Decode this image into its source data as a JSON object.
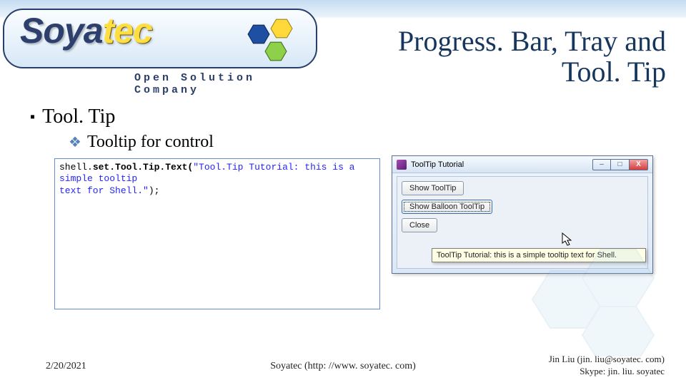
{
  "logo": {
    "brand_main": "Soya",
    "brand_alt": "tec",
    "tagline": "Open Solution Company"
  },
  "title_line1": "Progress. Bar, Tray and",
  "title_line2": "Tool. Tip",
  "bullet1": "Tool. Tip",
  "bullet2": "Tooltip for control",
  "code": {
    "part1": "shell.",
    "bold": "set.Tool.Tip.Text(",
    "str1": "\"Tool.Tip Tutorial: this is a simple tooltip",
    "str2": "text for Shell.\"",
    "part2": ");"
  },
  "demo_window": {
    "title": "ToolTip Tutorial",
    "buttons": {
      "show_tooltip": "Show ToolTip",
      "show_balloon": "Show Balloon ToolTip",
      "close": "Close"
    },
    "tooltip_text": "ToolTip Tutorial: this is a simple tooltip text for Shell."
  },
  "footer": {
    "date": "2/20/2021",
    "center": "Soyatec (http: //www. soyatec. com)",
    "right_line1": "Jin Liu (jin. liu@soyatec. com)",
    "right_line2": "Skype: jin. liu. soyatec"
  },
  "icons": {
    "minimize": "–",
    "maximize": "□",
    "close": "X"
  }
}
